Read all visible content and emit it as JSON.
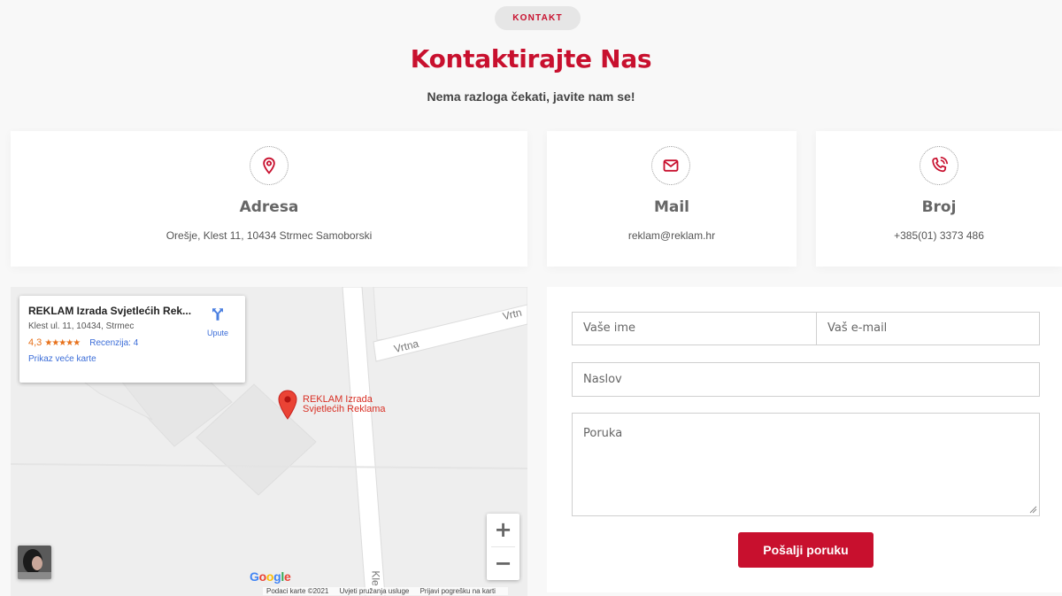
{
  "header": {
    "badge": "KONTAKT",
    "title": "Kontaktirajte Nas",
    "subtitle": "Nema razloga čekati, javite nam se!"
  },
  "cards": [
    {
      "icon": "location-pin-icon",
      "title": "Adresa",
      "value": "Orešje, Klest 11, 10434 Strmec Samoborski"
    },
    {
      "icon": "mail-icon",
      "title": "Mail",
      "value": "reklam@reklam.hr"
    },
    {
      "icon": "phone-icon",
      "title": "Broj",
      "value": "+385(01) 3373 486"
    }
  ],
  "map": {
    "place_name": "REKLAM Izrada Svjetlećih Rek...",
    "place_address": "Klest ul. 11, 10434, Strmec",
    "rating": "4,3",
    "stars": "★★★★★",
    "reviews": "Recenzija: 4",
    "larger_map": "Prikaz veće karte",
    "directions": "Upute",
    "marker_label_line1": "REKLAM Izrada",
    "marker_label_line2": "Svjetlećih Reklama",
    "street_1": "Vrtna",
    "street_2": "Vrtn",
    "street_3": "Kle",
    "google": "Google",
    "footer_data": "Podaci karte ©2021",
    "footer_terms": "Uvjeti pružanja usluge",
    "footer_report": "Prijavi pogrešku na karti",
    "zoom_in": "+",
    "zoom_out": "−"
  },
  "form": {
    "name_placeholder": "Vaše ime",
    "email_placeholder": "Vaš e-mail",
    "subject_placeholder": "Naslov",
    "message_placeholder": "Poruka",
    "submit_label": "Pošalji poruku"
  },
  "colors": {
    "accent": "#c8102e",
    "link": "#3b6dd8",
    "rating": "#e7711b"
  }
}
